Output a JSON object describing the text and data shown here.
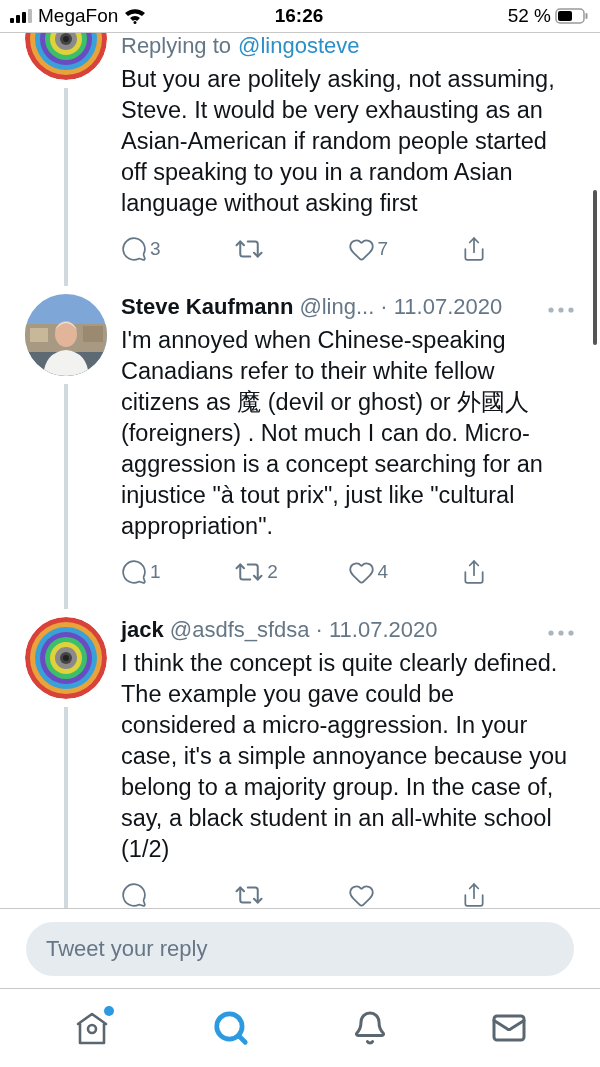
{
  "status_bar": {
    "carrier": "MegaFon",
    "time": "16:26",
    "battery": "52 %"
  },
  "tweets": [
    {
      "replying_to": {
        "label": "Replying to",
        "handle": "@lingosteve"
      },
      "text": "But you are politely asking, not assuming, Steve. It would be very exhausting as an Asian-American if random people started off speaking to you in a random Asian language without asking first",
      "actions": {
        "replies": "3",
        "likes": "7"
      }
    },
    {
      "name": "Steve Kaufmann",
      "handle": "@ling...",
      "date": "· 11.07.2020",
      "text": "I'm annoyed when Chinese-speaking Canadians refer to their white fellow citizens as 魔 (devil or ghost) or 外國人 (foreigners) . Not much I can do.  Micro-aggression is a concept searching for an injustice \"à tout prix\", just like \"cultural appropriation\".",
      "actions": {
        "replies": "1",
        "retweets": "2",
        "likes": "4"
      }
    },
    {
      "name": "jack",
      "handle": "@asdfs_sfdsa",
      "date": "· 11.07.2020",
      "text": "I think the concept is quite clearly defined. The example you gave could be considered a micro-aggression. In your case, it's a simple annoyance because you belong to a majority group. In the case of, say, a black student in an all-white school (1/2)"
    }
  ],
  "reply_box": {
    "placeholder": "Tweet your reply"
  },
  "nav": [
    {
      "kind": "home",
      "badge": true,
      "selected": false
    },
    {
      "kind": "search",
      "badge": false,
      "selected": true
    },
    {
      "kind": "notifications",
      "badge": false,
      "selected": false
    },
    {
      "kind": "messages",
      "badge": false,
      "selected": false
    }
  ]
}
